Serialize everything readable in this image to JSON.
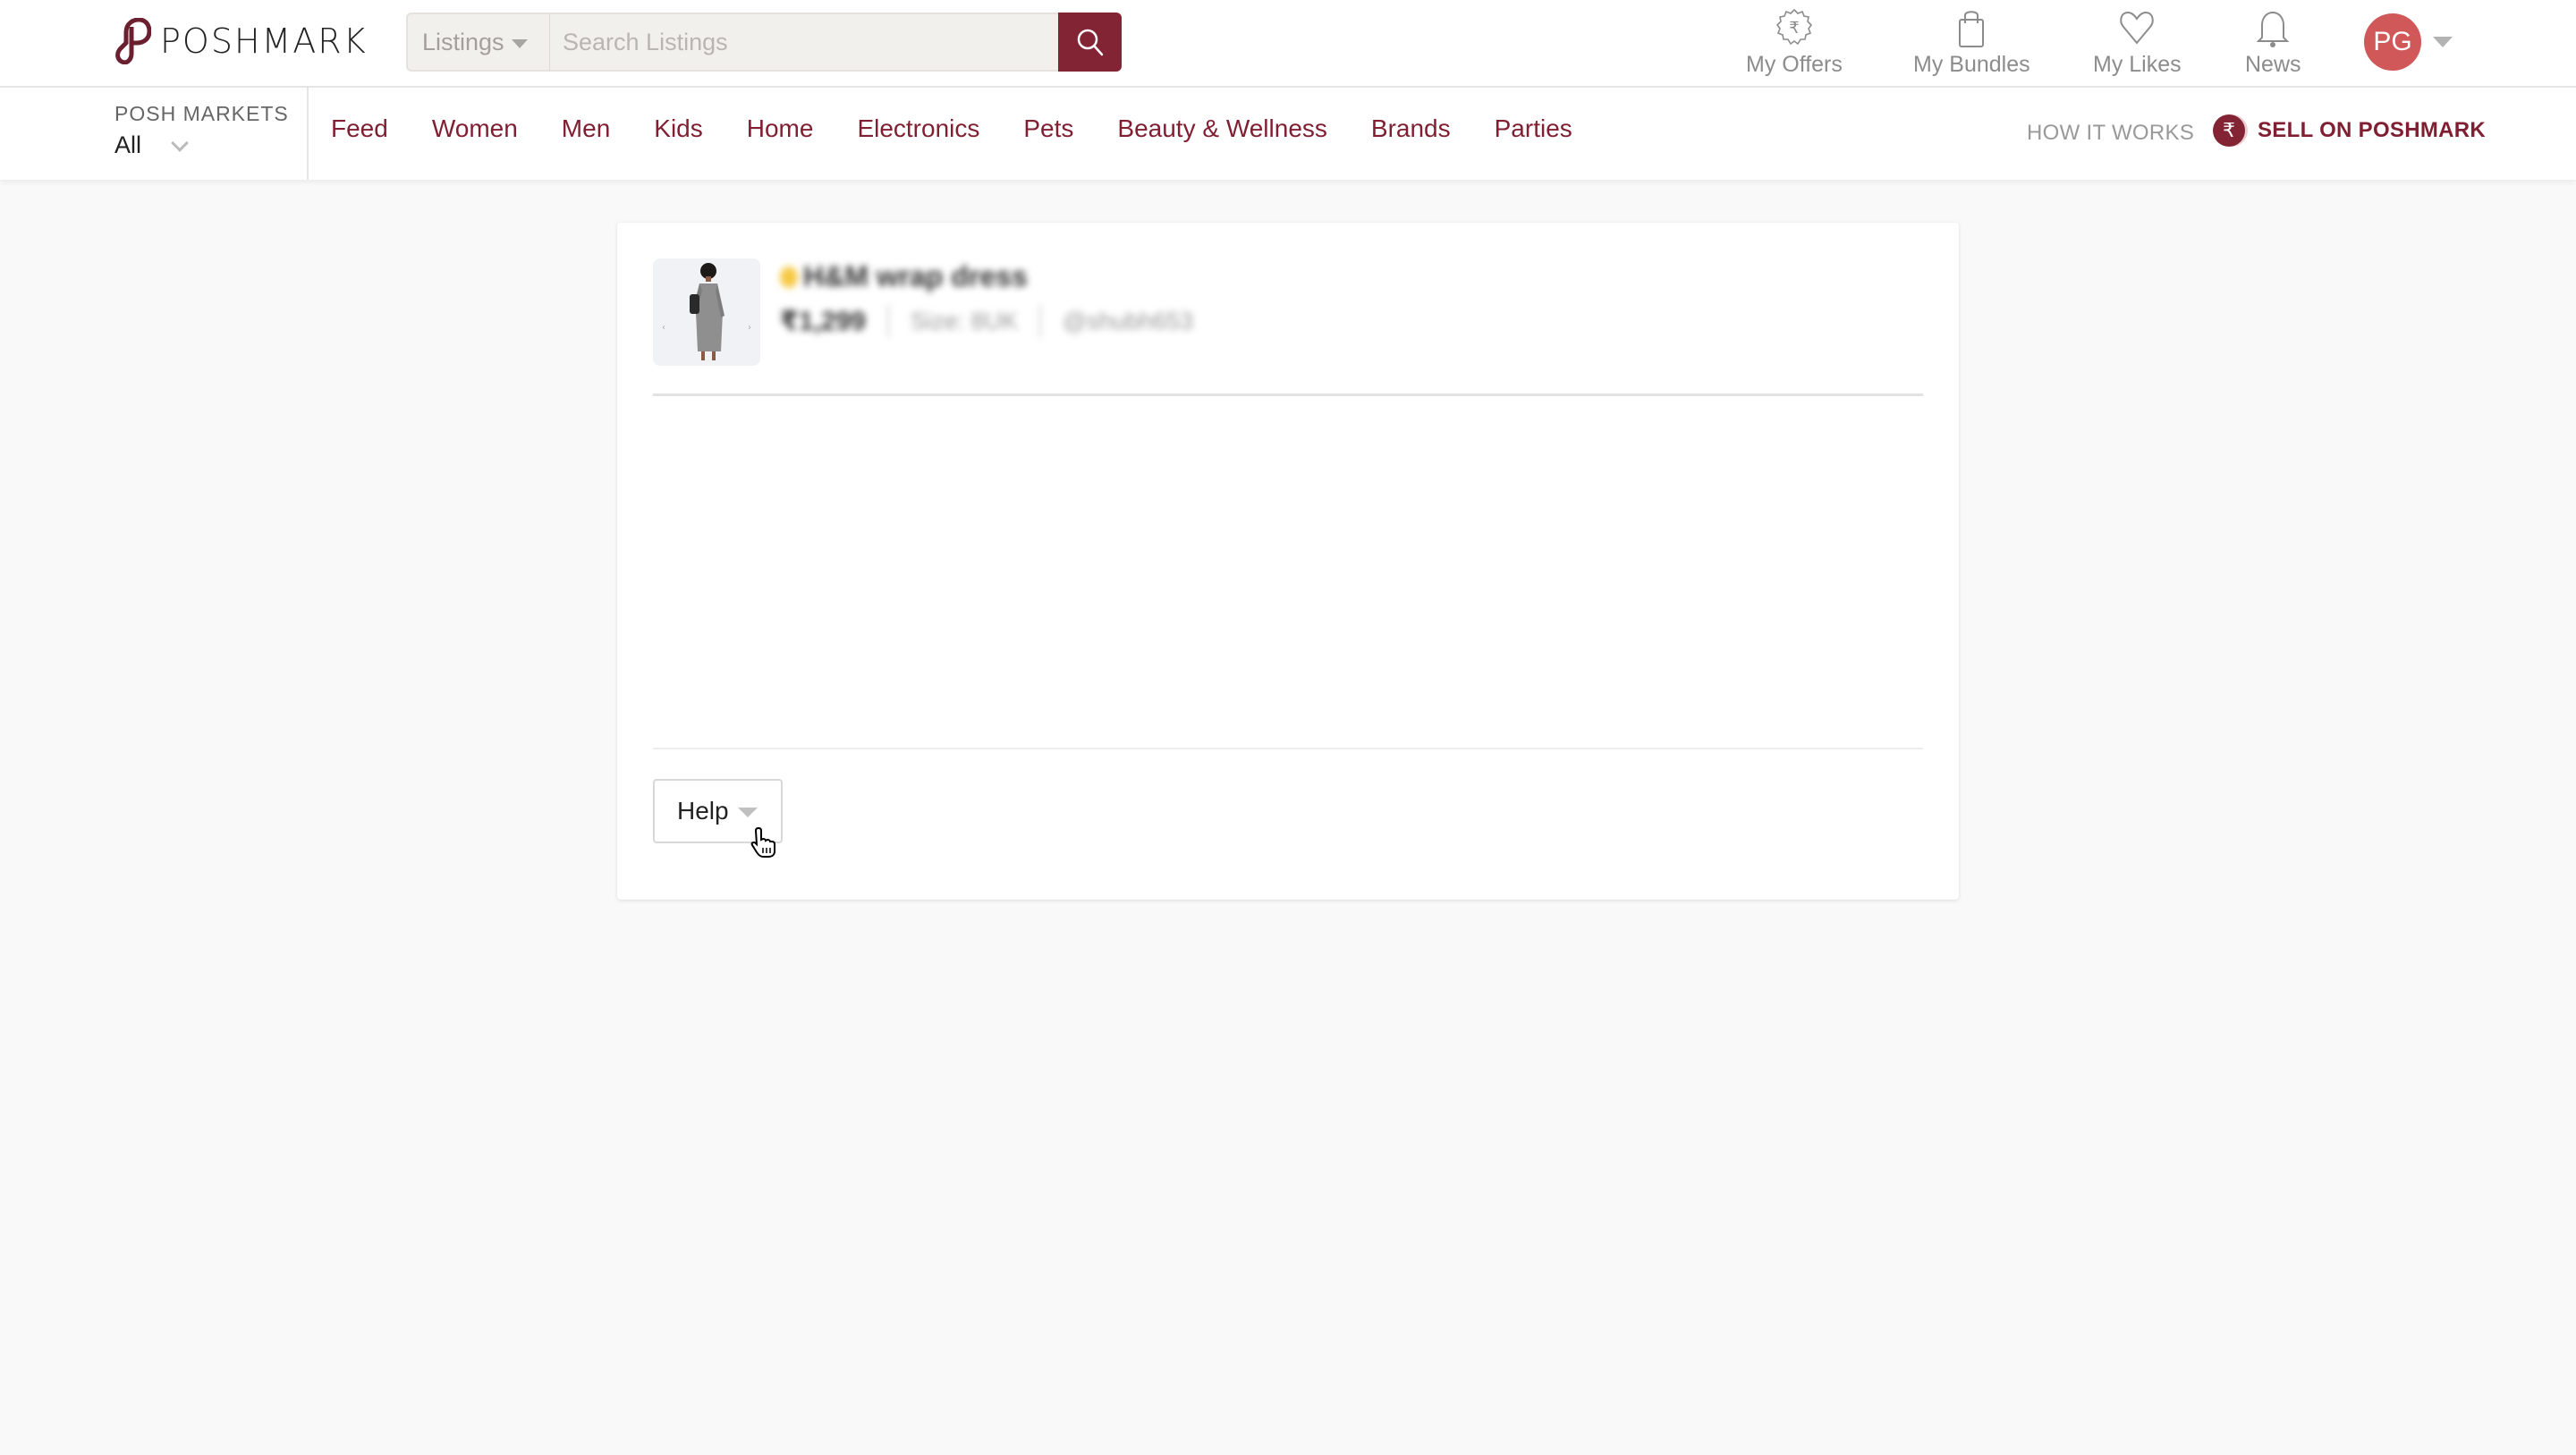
{
  "header": {
    "logo_text": "POSHMARK",
    "search": {
      "scope_label": "Listings",
      "placeholder": "Search Listings",
      "value": ""
    },
    "items": [
      {
        "label": "My Offers",
        "icon": "offers-rupee-badge-icon"
      },
      {
        "label": "My Bundles",
        "icon": "shopping-bag-icon"
      },
      {
        "label": "My Likes",
        "icon": "heart-icon"
      },
      {
        "label": "News",
        "icon": "bell-icon"
      }
    ],
    "avatar_initials": "PG",
    "colors": {
      "brand": "#822433",
      "avatar": "#d05858"
    }
  },
  "nav": {
    "markets_label": "POSH MARKETS",
    "markets_value": "All",
    "links": [
      "Feed",
      "Women",
      "Men",
      "Kids",
      "Home",
      "Electronics",
      "Pets",
      "Beauty & Wellness",
      "Brands",
      "Parties"
    ],
    "how_it_works": "HOW IT WORKS",
    "sell_label": "SELL ON POSHMARK",
    "sell_icon_glyph": "₹"
  },
  "listing": {
    "title": "H&M wrap dress",
    "price": "₹1,299",
    "size": "Size: 8UK",
    "seller": "@shubh653"
  },
  "help_button": {
    "label": "Help"
  }
}
